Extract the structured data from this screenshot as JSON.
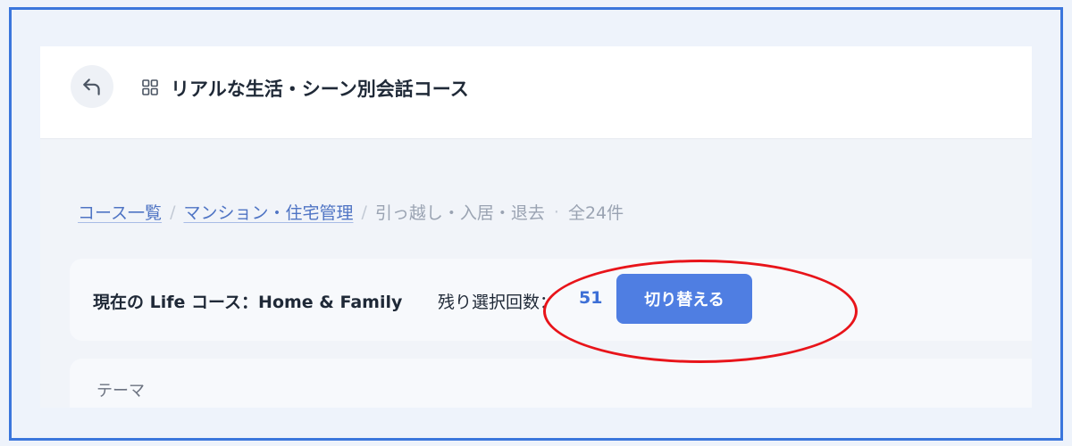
{
  "header": {
    "title": "リアルな生活・シーン別会話コース",
    "back_icon": "back-arrow-icon",
    "title_icon": "grid-icon"
  },
  "breadcrumb": {
    "items": [
      "コース一覧",
      "マンション・住宅管理",
      "引っ越し・入居・退去"
    ],
    "count": "全24件"
  },
  "course": {
    "label": "現在の Life コース：Home & Family",
    "remaining_label": "残り選択回数：",
    "remaining_count": "51",
    "switch_label": "切り替える"
  },
  "table": {
    "header": "テーマ"
  },
  "colors": {
    "accent": "#4f7ee2",
    "link": "#4f74c4",
    "frame": "#3b76dc",
    "annotation": "#e8141a"
  }
}
